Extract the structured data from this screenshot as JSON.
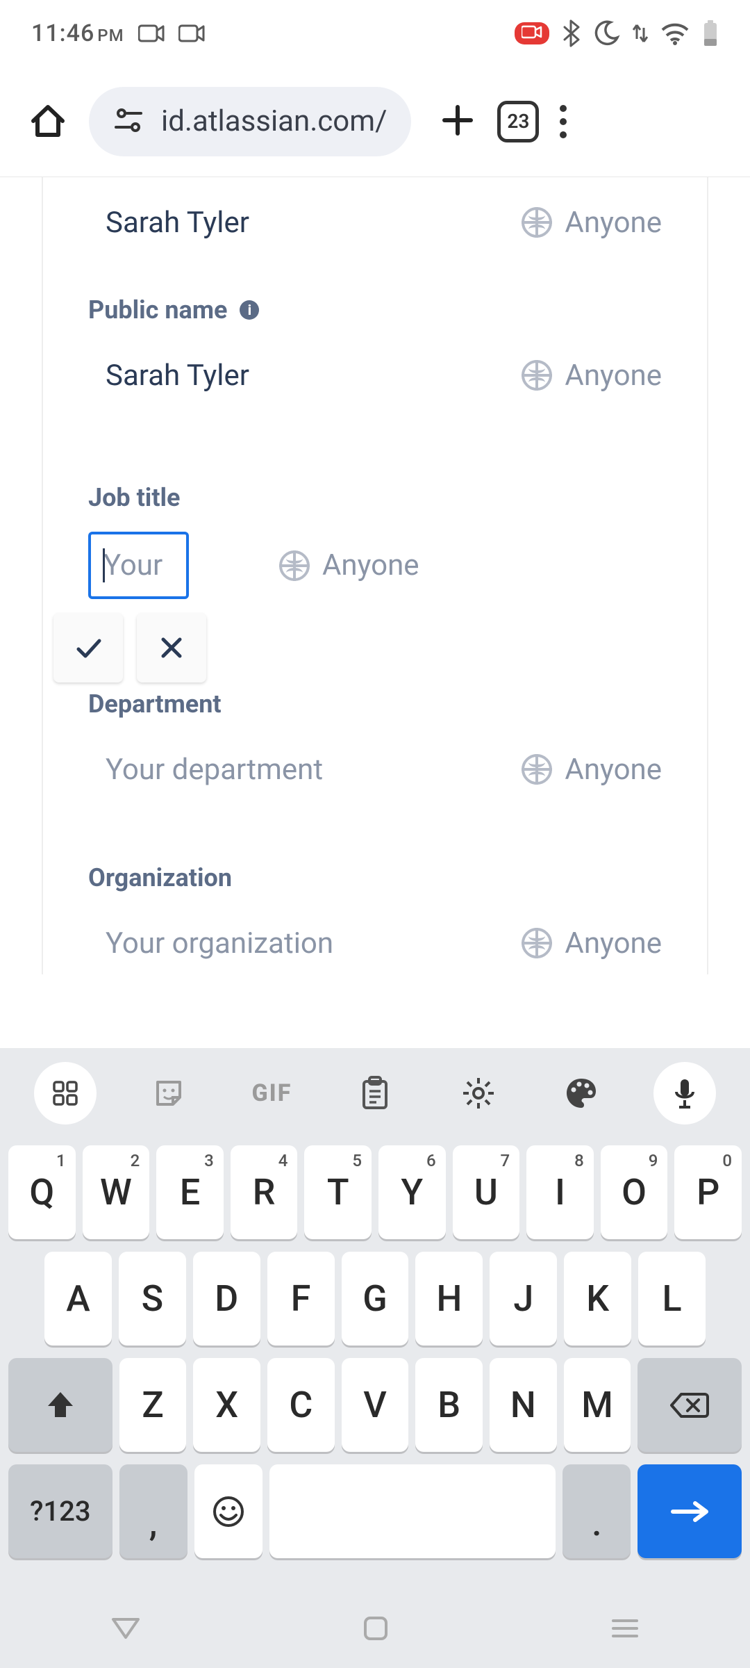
{
  "status": {
    "time": "11:46",
    "ampm": "PM"
  },
  "browser": {
    "url": "id.atlassian.com/",
    "tab_count": "23"
  },
  "profile": {
    "full_name": {
      "value": "Sarah Tyler",
      "visibility": "Anyone"
    },
    "public_name": {
      "label": "Public name",
      "value": "Sarah Tyler",
      "visibility": "Anyone"
    },
    "job_title": {
      "label": "Job title",
      "placeholder": "Your",
      "visibility": "Anyone"
    },
    "department": {
      "label": "Department",
      "placeholder": "Your department",
      "visibility": "Anyone"
    },
    "organization": {
      "label": "Organization",
      "placeholder": "Your organization",
      "visibility": "Anyone"
    }
  },
  "keyboard": {
    "toolbar_gif": "GIF",
    "row1": [
      {
        "k": "Q",
        "s": "1"
      },
      {
        "k": "W",
        "s": "2"
      },
      {
        "k": "E",
        "s": "3"
      },
      {
        "k": "R",
        "s": "4"
      },
      {
        "k": "T",
        "s": "5"
      },
      {
        "k": "Y",
        "s": "6"
      },
      {
        "k": "U",
        "s": "7"
      },
      {
        "k": "I",
        "s": "8"
      },
      {
        "k": "O",
        "s": "9"
      },
      {
        "k": "P",
        "s": "0"
      }
    ],
    "row2": [
      "A",
      "S",
      "D",
      "F",
      "G",
      "H",
      "J",
      "K",
      "L"
    ],
    "row3": [
      "Z",
      "X",
      "C",
      "V",
      "B",
      "N",
      "M"
    ],
    "symbols_label": "?123",
    "comma": ",",
    "dot": "."
  }
}
